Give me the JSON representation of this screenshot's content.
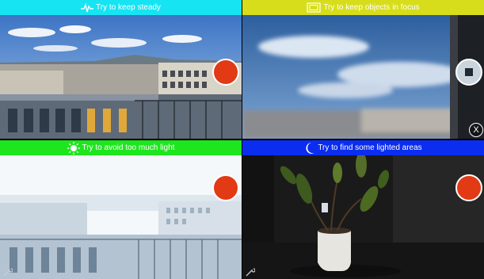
{
  "panels": [
    {
      "banner_text": "Try to keep steady",
      "banner_color": "#16e4f2",
      "icon": "heartbeat-icon",
      "button": "record"
    },
    {
      "banner_text": "Try to keep objects in focus",
      "banner_color": "#d7dd1a",
      "icon": "focus-frame-icon",
      "button": "stop"
    },
    {
      "banner_text": "Try to avoid too much light",
      "banner_color": "#1ee61e",
      "icon": "sun-icon",
      "button": "record"
    },
    {
      "banner_text": "Try to find some lighted areas",
      "banner_color": "#0b2df0",
      "icon": "moon-icon",
      "button": "record"
    }
  ],
  "close_label": "X",
  "colors": {
    "record": "#e23a14",
    "stop_bg": "#c9d4dc"
  }
}
